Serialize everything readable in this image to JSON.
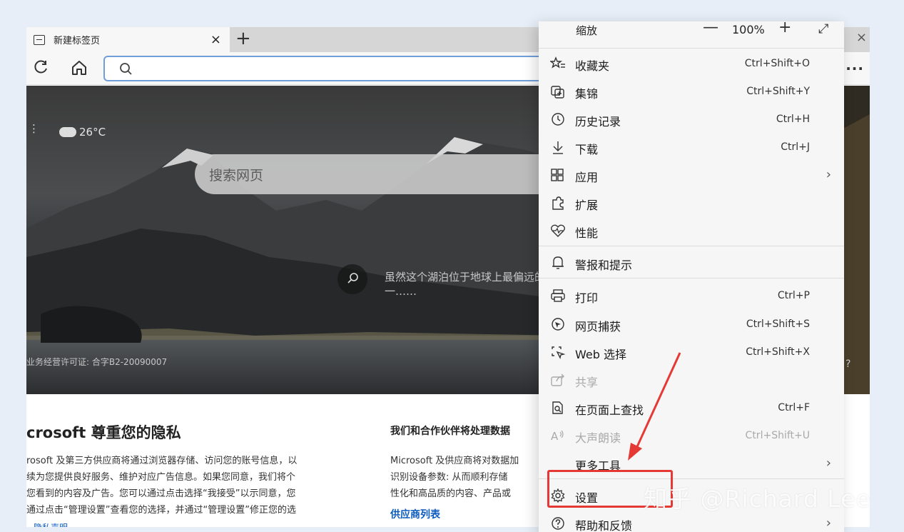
{
  "tab": {
    "title": "新建标签页",
    "close": "×",
    "new_tab": "+"
  },
  "window": {
    "close": "×"
  },
  "toolbar": {
    "refresh": "C",
    "more": "..."
  },
  "hero": {
    "weather_temp": "26°C",
    "search_placeholder": "搜索网页",
    "image_caption": "虽然这个湖泊位于地球上最偏远的地区之一……",
    "license": "业务经营许可证: 合字B2-20090007",
    "edge_mark": "?"
  },
  "privacy": {
    "title": "crosoft 尊重您的隐私",
    "body_lines": [
      "rosoft 及第三方供应商将通过浏览器存储、访问您的账号信息，以",
      "续为您提供良好服务、维护对应广告信息。如果您同意，我们将个",
      "您看到的内容及广告。您可以通过点击选择“我接受”以示同意，您",
      "通过点击“管理设置”查看您的选择，并通过“管理设置”修正您的选"
    ],
    "link": "隐私声明",
    "partner_title": "我们和合作伙伴将处理数据",
    "partner_lines": [
      "Microsoft 及供应商将对数据加",
      "识别设备参数: 从而顺利存储",
      "性化和高品质的内容、产品或"
    ],
    "vendor_link": "供应商列表"
  },
  "menu": {
    "zoom": {
      "label": "缩放",
      "minus": "—",
      "value": "100%",
      "plus": "+",
      "fullscreen": "⤢"
    },
    "items": [
      {
        "label": "收藏夹",
        "shortcut": "Ctrl+Shift+O",
        "icon": "favorites-icon"
      },
      {
        "label": "集锦",
        "shortcut": "Ctrl+Shift+Y",
        "icon": "collections-icon"
      },
      {
        "label": "历史记录",
        "shortcut": "Ctrl+H",
        "icon": "history-icon"
      },
      {
        "label": "下载",
        "shortcut": "Ctrl+J",
        "icon": "download-icon"
      },
      {
        "label": "应用",
        "shortcut": "",
        "icon": "apps-icon",
        "arrow": "›"
      },
      {
        "label": "扩展",
        "shortcut": "",
        "icon": "extensions-icon"
      },
      {
        "label": "性能",
        "shortcut": "",
        "icon": "performance-icon"
      },
      {
        "label": "警报和提示",
        "shortcut": "",
        "icon": "alerts-icon"
      },
      {
        "label": "打印",
        "shortcut": "Ctrl+P",
        "icon": "print-icon"
      },
      {
        "label": "网页捕获",
        "shortcut": "Ctrl+Shift+S",
        "icon": "web-capture-icon"
      },
      {
        "label": "Web 选择",
        "shortcut": "Ctrl+Shift+X",
        "icon": "web-select-icon"
      },
      {
        "label": "共享",
        "shortcut": "",
        "icon": "share-icon",
        "disabled": true
      },
      {
        "label": "在页面上查找",
        "shortcut": "Ctrl+F",
        "icon": "find-icon"
      },
      {
        "label": "大声朗读",
        "shortcut": "Ctrl+Shift+U",
        "icon": "read-aloud-icon",
        "disabled": true
      },
      {
        "label": "更多工具",
        "shortcut": "",
        "icon": "",
        "arrow": "›"
      },
      {
        "label": "设置",
        "shortcut": "",
        "icon": "gear-icon"
      },
      {
        "label": "帮助和反馈",
        "shortcut": "",
        "icon": "help-icon",
        "arrow": "›"
      }
    ]
  },
  "annotation": {
    "color": "#e53935"
  },
  "watermark": "知乎 @Richard Lee"
}
